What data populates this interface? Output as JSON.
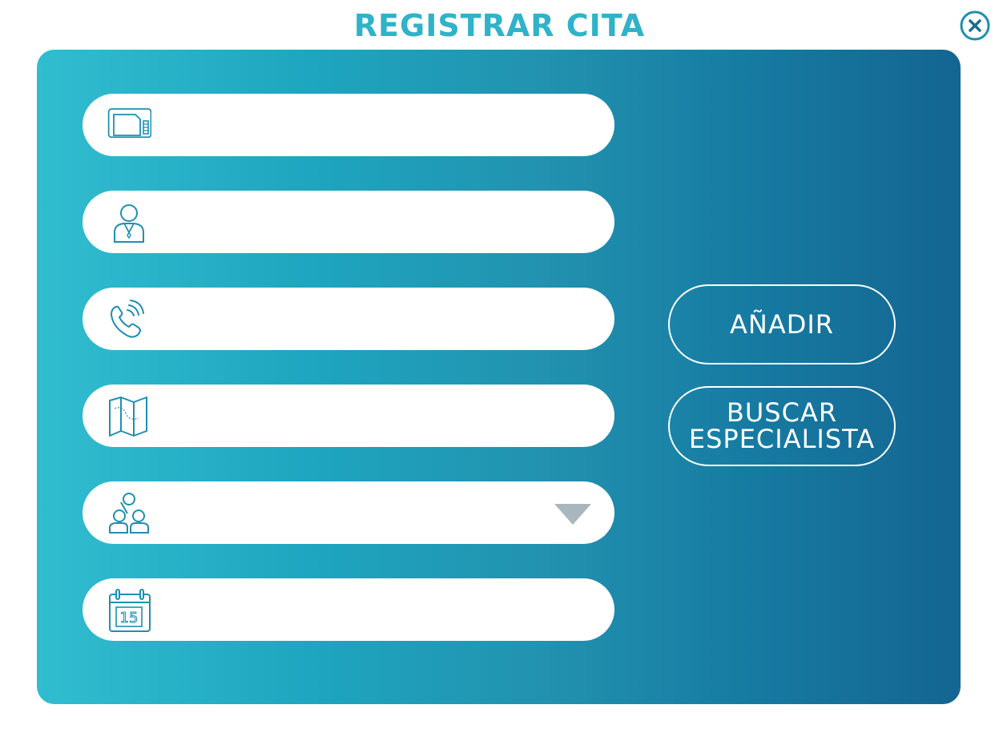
{
  "dialog": {
    "title": "REGISTRAR CITA",
    "close_icon": "close-icon"
  },
  "colors": {
    "accent": "#2fb3c9",
    "panel_gradient_start": "#31bdd0",
    "panel_gradient_end": "#146592",
    "icon_stroke": "#1f8fb0",
    "arrow": "#a9b6bd"
  },
  "form": {
    "fields": [
      {
        "icon": "id-card-icon",
        "value": "",
        "placeholder": ""
      },
      {
        "icon": "person-icon",
        "value": "",
        "placeholder": ""
      },
      {
        "icon": "phone-icon",
        "value": "",
        "placeholder": ""
      },
      {
        "icon": "map-icon",
        "value": "",
        "placeholder": ""
      },
      {
        "icon": "specialists-group-icon",
        "value": "",
        "placeholder": "",
        "type": "dropdown"
      },
      {
        "icon": "calendar-icon",
        "value": "",
        "placeholder": "",
        "calendar_day": "15"
      }
    ]
  },
  "actions": {
    "add_label": "AÑADIR",
    "search_label_line1": "BUSCAR",
    "search_label_line2": "ESPECIALISTA"
  }
}
